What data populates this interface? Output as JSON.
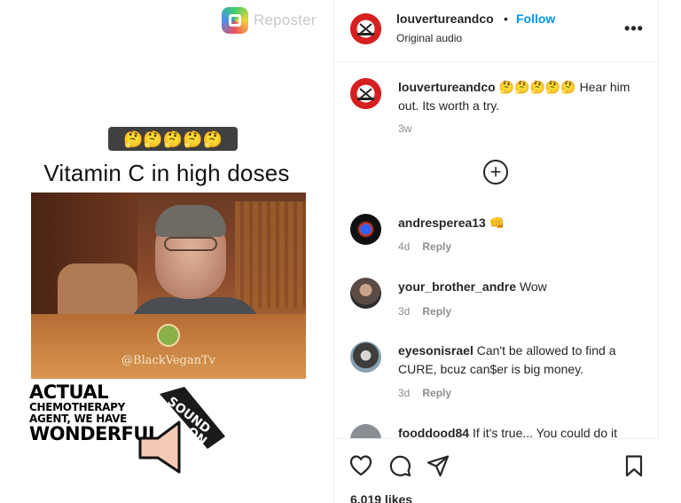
{
  "media": {
    "reposter_label": "Reposter",
    "emoji_bar": "🤔🤔🤔🤔🤔",
    "caption_title": "Vitamin C in high doses",
    "video_watermark": "@BlackVeganTv",
    "overlay_lines": [
      "ACTUAL",
      "CHEMOTHERAPY",
      "AGENT, WE HAVE",
      "WONDERFUL,"
    ],
    "sound_badge": [
      "SOUND",
      "ON"
    ]
  },
  "header": {
    "username": "louvertureandco",
    "dot": "•",
    "follow_label": "Follow",
    "audio_label": "Original audio",
    "more_label": "•••"
  },
  "caption": {
    "username": "louvertureandco",
    "emojis": "🤔🤔🤔🤔🤔",
    "text": "Hear him out. Its worth a try.",
    "time": "3w"
  },
  "load_more_label": "+",
  "comments": [
    {
      "username": "andresperea13",
      "text": "👊",
      "time": "4d",
      "reply": "Reply"
    },
    {
      "username": "your_brother_andre",
      "text": "Wow",
      "time": "3d",
      "reply": "Reply"
    },
    {
      "username": "eyesonisrael",
      "text": "Can't be allowed to find a CURE, bcuz can$er is big money.",
      "time": "3d",
      "reply": "Reply"
    },
    {
      "username": "fooddood84",
      "text": "If it's true... You could do it"
    }
  ],
  "actions": {
    "icons": [
      "heart-icon",
      "comment-icon",
      "share-icon",
      "bookmark-icon"
    ],
    "likes": "6,019 likes"
  },
  "colors": {
    "accent": "#0095f6",
    "text": "#262626",
    "muted": "#8e8e8e"
  }
}
